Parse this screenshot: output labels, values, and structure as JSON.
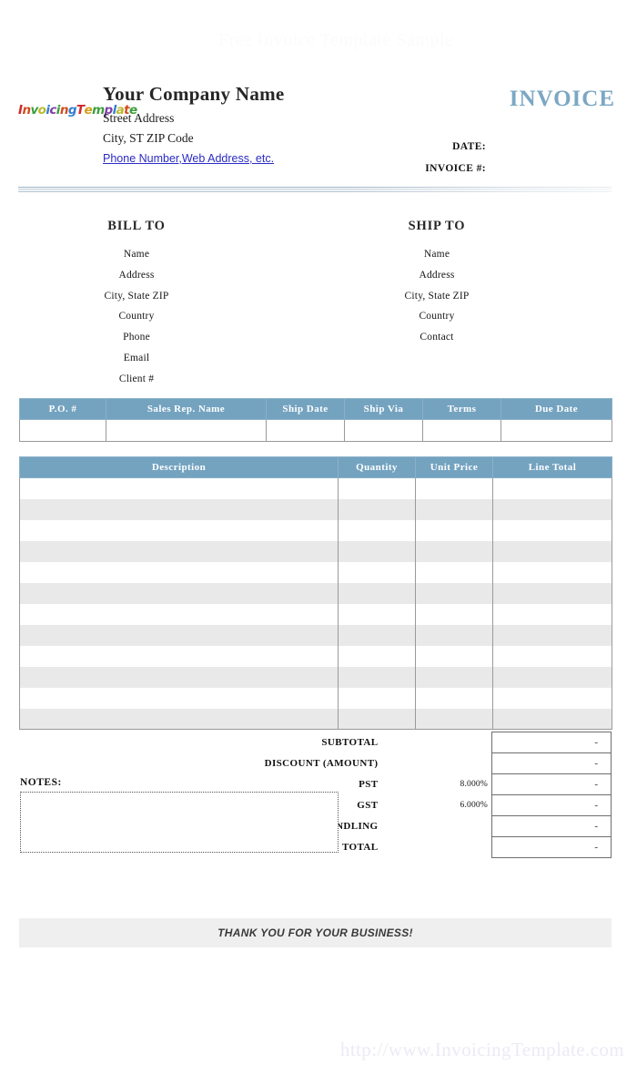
{
  "watermark": {
    "top": "Free Invoice Template Sample",
    "bottom": "http://www.InvoicingTemplate.com"
  },
  "brand": {
    "accent_blue": "#74a3c0",
    "title_blue": "#7ba7c4",
    "link_blue": "#2b2bc4",
    "stripe_gray": "#e9e9e9",
    "logo_text": "InvoicingTemplate",
    "logo_letters": [
      {
        "ch": "I",
        "color": "#cc2a2a"
      },
      {
        "ch": "n",
        "color": "#d24b1e"
      },
      {
        "ch": "v",
        "color": "#3b9e3b"
      },
      {
        "ch": "o",
        "color": "#b8b82a"
      },
      {
        "ch": "i",
        "color": "#2f7fd0"
      },
      {
        "ch": "c",
        "color": "#7d3fa8"
      },
      {
        "ch": "i",
        "color": "#3b9e3b"
      },
      {
        "ch": "n",
        "color": "#d24b1e"
      },
      {
        "ch": "g",
        "color": "#2f7fd0"
      },
      {
        "ch": "T",
        "color": "#cc2a2a"
      },
      {
        "ch": "e",
        "color": "#d2a01e"
      },
      {
        "ch": "m",
        "color": "#3b9e3b"
      },
      {
        "ch": "p",
        "color": "#7d3fa8"
      },
      {
        "ch": "l",
        "color": "#2f7fd0"
      },
      {
        "ch": "a",
        "color": "#b8b82a"
      },
      {
        "ch": "t",
        "color": "#d24b1e"
      },
      {
        "ch": "e",
        "color": "#3b9e3b"
      }
    ]
  },
  "header": {
    "company_name": "Your Company Name",
    "street": "Street Address",
    "city_state_zip": "City, ST  ZIP Code",
    "contact_link": "Phone Number,Web Address, etc.",
    "invoice_title": "INVOICE",
    "date_label": "DATE:",
    "invoice_no_label": "INVOICE #:",
    "date_value": "",
    "invoice_no_value": ""
  },
  "bill_to": {
    "title": "BILL TO",
    "lines": [
      "Name",
      "Address",
      "City, State ZIP",
      "Country",
      "Phone",
      "Email",
      "Client #"
    ]
  },
  "ship_to": {
    "title": "SHIP TO",
    "lines": [
      "Name",
      "Address",
      "City, State ZIP",
      "Country",
      "Contact"
    ]
  },
  "info_table": {
    "headers": [
      "P.O. #",
      "Sales Rep. Name",
      "Ship Date",
      "Ship Via",
      "Terms",
      "Due Date"
    ],
    "row": [
      "",
      "",
      "",
      "",
      "",
      ""
    ]
  },
  "items_table": {
    "headers": [
      "Description",
      "Quantity",
      "Unit Price",
      "Line Total"
    ],
    "row_count": 12,
    "rows": [
      [
        "",
        "",
        "",
        ""
      ],
      [
        "",
        "",
        "",
        ""
      ],
      [
        "",
        "",
        "",
        ""
      ],
      [
        "",
        "",
        "",
        ""
      ],
      [
        "",
        "",
        "",
        ""
      ],
      [
        "",
        "",
        "",
        ""
      ],
      [
        "",
        "",
        "",
        ""
      ],
      [
        "",
        "",
        "",
        ""
      ],
      [
        "",
        "",
        "",
        ""
      ],
      [
        "",
        "",
        "",
        ""
      ],
      [
        "",
        "",
        "",
        ""
      ],
      [
        "",
        "",
        "",
        ""
      ]
    ]
  },
  "totals": [
    {
      "label": "SUBTOTAL",
      "rate": "",
      "value": "-"
    },
    {
      "label": "DISCOUNT (AMOUNT)",
      "rate": "",
      "value": "-"
    },
    {
      "label": "PST",
      "rate": "8.000%",
      "value": "-"
    },
    {
      "label": "GST",
      "rate": "6.000%",
      "value": "-"
    },
    {
      "label": "SHIPPING & HANDLING",
      "rate": "",
      "value": "-"
    },
    {
      "label": "TOTAL",
      "rate": "",
      "value": "-"
    }
  ],
  "notes": {
    "label": "NOTES:",
    "value": ""
  },
  "footer": {
    "thanks": "THANK YOU FOR YOUR BUSINESS!"
  }
}
